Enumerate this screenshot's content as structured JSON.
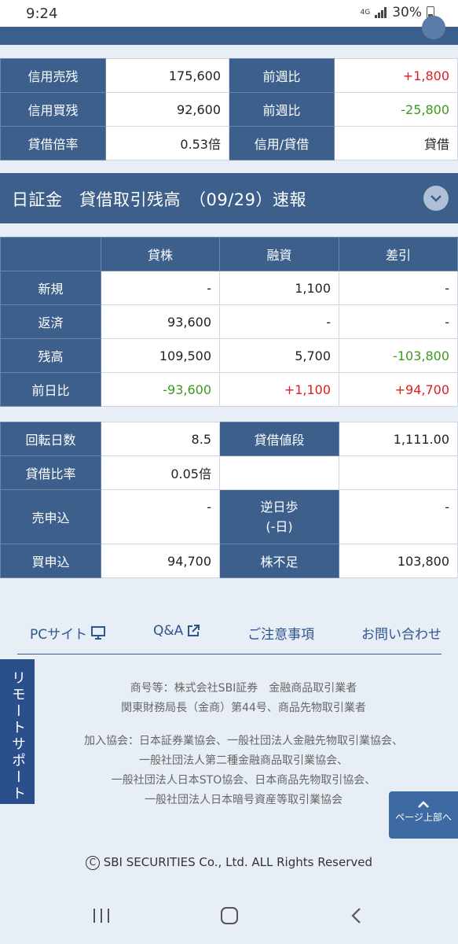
{
  "status": {
    "time": "9:24",
    "network": "4G",
    "battery": "30%"
  },
  "margin_table": {
    "rows": [
      {
        "l1": "信用売残",
        "v1": "175,600",
        "l2": "前週比",
        "v2": "+1,800"
      },
      {
        "l1": "信用買残",
        "v1": "92,600",
        "l2": "前週比",
        "v2": "-25,800"
      },
      {
        "l1": "貸借倍率",
        "v1": "0.53倍",
        "l2": "信用/貸借",
        "v2": "貸借"
      }
    ]
  },
  "section": {
    "title": "日証金　貸借取引残高　（09/29）速報"
  },
  "lending_table": {
    "headers": [
      "貸株",
      "融資",
      "差引"
    ],
    "rows": [
      {
        "label": "新規",
        "values": [
          "-",
          "1,100",
          "-"
        ]
      },
      {
        "label": "返済",
        "values": [
          "93,600",
          "-",
          "-"
        ]
      },
      {
        "label": "残高",
        "values": [
          "109,500",
          "5,700",
          "-103,800"
        ]
      },
      {
        "label": "前日比",
        "values": [
          "-93,600",
          "+1,100",
          "+94,700"
        ]
      }
    ]
  },
  "stats_table": {
    "rows": [
      {
        "l1": "回転日数",
        "v1": "8.5",
        "l2": "貸借値段",
        "v2": "1,111.00"
      },
      {
        "l1": "貸借比率",
        "v1": "0.05倍",
        "l2": "",
        "v2": ""
      },
      {
        "l1": "売申込",
        "v1": "-",
        "l2a": "逆日歩",
        "l2b": "(-日)",
        "v2": "-"
      },
      {
        "l1": "買申込",
        "v1": "94,700",
        "l2": "株不足",
        "v2": "103,800"
      }
    ]
  },
  "footer": {
    "links": [
      "PCサイト",
      "Q&A",
      "ご注意事項",
      "お問い合わせ"
    ],
    "company_lines": [
      "商号等：株式会社SBI証券　金融商品取引業者",
      "関東財務局長（金商）第44号、商品先物取引業者"
    ],
    "association_lines": [
      "加入協会：日本証券業協会、一般社団法人金融先物取引業協会、",
      "一般社団法人第二種金融商品取引業協会、",
      "一般社団法人日本STO協会、日本商品先物取引協会、",
      "一般社団法人日本暗号資産等取引業協会"
    ],
    "remote_support": "リモートサポート",
    "page_top": "ページ上部へ",
    "copyright": "SBI SECURITIES Co., Ltd. ALL Rights Reserved"
  },
  "colors": {
    "header_blue": "#3d5f8c",
    "positive": "#e01c1c",
    "negative": "#3a9a1f"
  }
}
